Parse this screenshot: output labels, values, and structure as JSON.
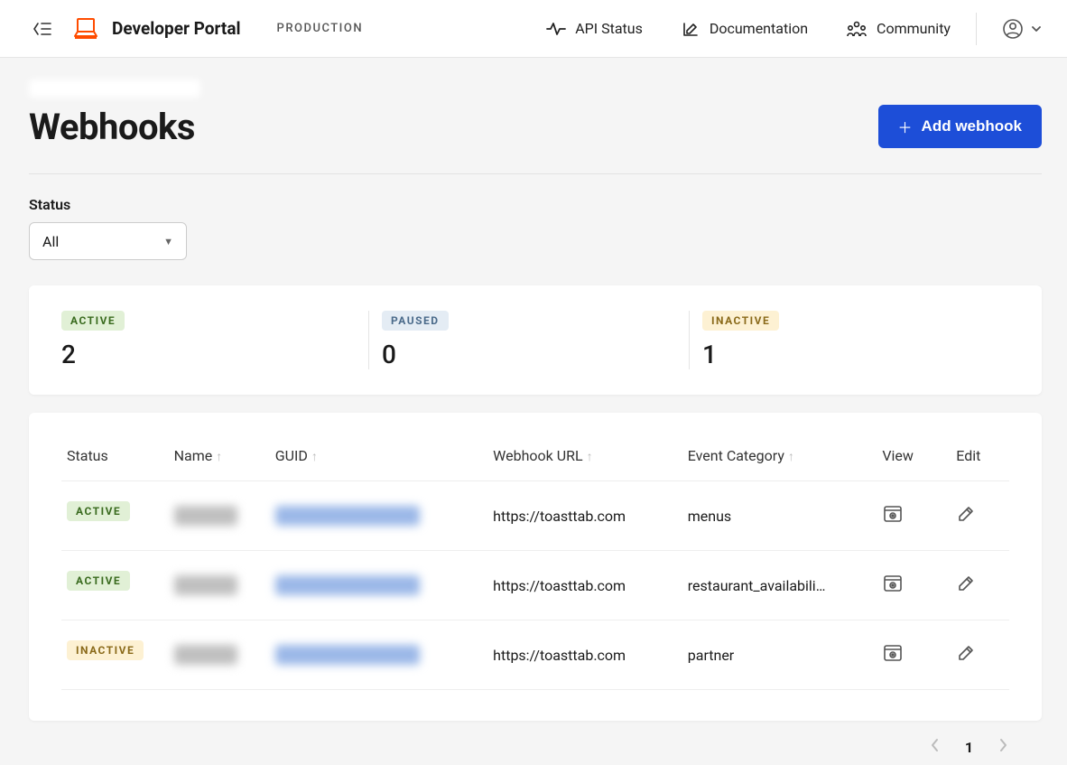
{
  "header": {
    "portal_title": "Developer Portal",
    "environment": "PRODUCTION",
    "nav": {
      "api_status": "API Status",
      "documentation": "Documentation",
      "community": "Community"
    }
  },
  "page": {
    "title": "Webhooks",
    "add_button": "Add webhook"
  },
  "filter": {
    "label": "Status",
    "value": "All"
  },
  "summary": {
    "active": {
      "label": "ACTIVE",
      "count": "2"
    },
    "paused": {
      "label": "PAUSED",
      "count": "0"
    },
    "inactive": {
      "label": "INACTIVE",
      "count": "1"
    }
  },
  "table": {
    "columns": {
      "status": "Status",
      "name": "Name",
      "guid": "GUID",
      "url": "Webhook URL",
      "category": "Event Category",
      "view": "View",
      "edit": "Edit"
    },
    "rows": [
      {
        "status": "ACTIVE",
        "status_class": "active",
        "url": "https://toasttab.com",
        "category": "menus"
      },
      {
        "status": "ACTIVE",
        "status_class": "active",
        "url": "https://toasttab.com",
        "category": "restaurant_availabili…"
      },
      {
        "status": "INACTIVE",
        "status_class": "inactive",
        "url": "https://toasttab.com",
        "category": "partner"
      }
    ]
  },
  "pagination": {
    "current": "1"
  }
}
